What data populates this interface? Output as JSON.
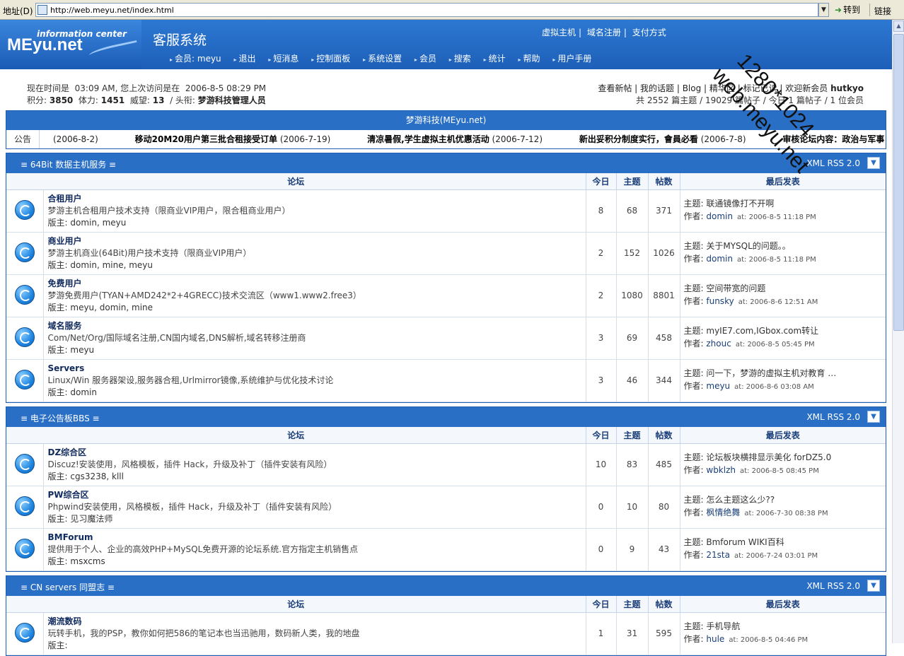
{
  "browser": {
    "address_label": "地址(D)",
    "url": "http://web.meyu.net/index.html",
    "go_label": "转到",
    "links_label": "链接"
  },
  "header": {
    "logo_small": "information center",
    "logo_big": "MEyu.net",
    "site_title": "客服系统",
    "top_links": [
      "虚拟主机",
      "域名注册",
      "支付方式"
    ],
    "nav": [
      "会员: meyu",
      "退出",
      "短消息",
      "控制面板",
      "系统设置",
      "会员",
      "搜索",
      "统计",
      "帮助",
      "用户手册"
    ]
  },
  "info": {
    "time_prefix": "现在时间是",
    "time_value": "03:09 AM, 您上次访问是在",
    "last_visit": "2006-8-5 08:29 PM",
    "credits_label": "积分:",
    "credits": "3850",
    "stamina_label": "体力:",
    "stamina": "1451",
    "prestige_label": "威望:",
    "prestige": "13",
    "title_label": "/ 头衔:",
    "title": "梦游科技管理人员",
    "links": [
      "查看新帖",
      "我的话题",
      "Blog",
      "精华区",
      "标记已读"
    ],
    "welcome": "欢迎新会员",
    "newest_member": "hutkyo",
    "stats": "共  2552 篇主题 / 19029 篇帖子 / 今日 1 篇帖子 / 1 位会员"
  },
  "announcement": {
    "title": "梦游科技(MEyu.net)",
    "label": "公告",
    "items": [
      {
        "title": "",
        "date": "(2006-8-2)"
      },
      {
        "title": "移动20M20用户第三批合租接受订单",
        "date": "(2006-7-19)"
      },
      {
        "title": "清凉暑假,学生虚拟主机优惠活动",
        "date": "(2006-7-12)"
      },
      {
        "title": "新出妥积分制度实行，會員必看",
        "date": "(2006-7-8)"
      },
      {
        "title": "审核论坛内容：政治与军事",
        "date": ""
      }
    ]
  },
  "columns": {
    "forum": "论坛",
    "today": "今日",
    "topics": "主题",
    "posts": "帖数",
    "last": "最后发表"
  },
  "last_labels": {
    "topic": "主题:",
    "author": "作者:",
    "at": "at:"
  },
  "mod_label": "版主:",
  "rss": "XML   RSS 2.0",
  "categories": [
    {
      "name": "≡ 64Bit 数据主机服务 ≡",
      "forums": [
        {
          "name": "合租用户",
          "desc": "梦游主机合租用户技术支持（限商业VIP用户，限合租商业用户）",
          "mods": "domin, meyu",
          "today": "8",
          "topics": "68",
          "posts": "371",
          "last_topic": "联通镜像打不开啊",
          "last_author": "domin",
          "last_time": "2006-8-5 11:18 PM"
        },
        {
          "name": "商业用户",
          "desc": "梦游主机商业(64Bit)用户技术支持（限商业VIP用户）",
          "mods": "domin, mine, meyu",
          "today": "2",
          "topics": "152",
          "posts": "1026",
          "last_topic": "关于MYSQL的问题。。",
          "last_author": "domin",
          "last_time": "2006-8-5 11:18 PM"
        },
        {
          "name": "免费用户",
          "desc": "梦游免费用户(TYAN+AMD242*2+4GRECC)技术交流区（www1.www2.free3）",
          "mods": "meyu, domin, mine",
          "today": "2",
          "topics": "1080",
          "posts": "8801",
          "last_topic": "空间带宽的问题",
          "last_author": "funsky",
          "last_time": "2006-8-6 12:51 AM"
        },
        {
          "name": "域名服务",
          "desc": "Com/Net/Org/国际域名注册,CN国内域名,DNS解析,域名转移注册商",
          "mods": "meyu",
          "today": "3",
          "topics": "69",
          "posts": "458",
          "last_topic": "myIE7.com,IGbox.com转让",
          "last_author": "zhouc",
          "last_time": "2006-8-5 05:45 PM"
        },
        {
          "name": "Servers",
          "desc": "Linux/Win 服务器架设,服务器合租,Urlmirror镜像,系统维护与优化技术讨论",
          "mods": "domin",
          "today": "3",
          "topics": "46",
          "posts": "344",
          "last_topic": "问一下，梦游的虚拟主机对教育 …",
          "last_author": "meyu",
          "last_time": "2006-8-6 03:08 AM"
        }
      ]
    },
    {
      "name": "≡ 电子公告板BBS ≡",
      "forums": [
        {
          "name": "DZ综合区",
          "desc": "Discuz!安装使用，风格模板，插件 Hack，升级及补丁（插件安装有风险）",
          "mods": "cgs3238, klll",
          "today": "10",
          "topics": "83",
          "posts": "485",
          "last_topic": "论坛板块横排显示美化 forDZ5.0",
          "last_author": "wbklzh",
          "last_time": "2006-8-5 08:45 PM"
        },
        {
          "name": "PW综合区",
          "desc": "Phpwind安装使用，风格模板，插件 Hack，升级及补丁（插件安装有风险）",
          "mods": "见习魔法师",
          "today": "0",
          "topics": "10",
          "posts": "80",
          "last_topic": "怎么主题这么少??",
          "last_author": "枫情绝舞",
          "last_time": "2006-7-30 08:38 PM"
        },
        {
          "name": "BMForum",
          "desc": "提供用于个人、企业的高效PHP+MySQL免费开源的论坛系统.官方指定主机销售点",
          "mods": "msxcms",
          "today": "0",
          "topics": "9",
          "posts": "43",
          "last_topic": "Bmforum WIKI百科",
          "last_author": "21sta",
          "last_time": "2006-7-24 03:01 PM"
        }
      ]
    },
    {
      "name": "≡ CN servers 同盟志 ≡",
      "forums": [
        {
          "name": "潮流数码",
          "desc": "玩转手机，我的PSP，教你如何把586的笔记本也当迅驰用，数码新人类，我的地盘",
          "mods": "",
          "today": "1",
          "topics": "31",
          "posts": "595",
          "last_topic": "手机导航",
          "last_author": "hule",
          "last_time": "2006-8-5 04:46 PM"
        }
      ]
    }
  ],
  "watermark": {
    "line1": "1280*1024",
    "line2": "web.meyu.net"
  }
}
